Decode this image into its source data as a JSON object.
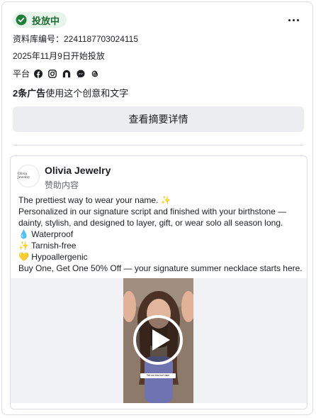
{
  "status": {
    "label": "投放中",
    "color": "#1e6a33",
    "icon": "check-circle-icon"
  },
  "menu": {
    "icon": "more-horizontal-icon"
  },
  "meta": {
    "library_id": "资料库编号：2241187703024115",
    "start_date": "2025年11月9日开始投放",
    "platform_label": "平台",
    "platform_icons": [
      "facebook-icon",
      "instagram-icon",
      "audience-network-icon",
      "messenger-icon",
      "threads-icon"
    ]
  },
  "ads_summary": {
    "count": "2条广告",
    "suffix": "使用这个创意和文字"
  },
  "detail_button": {
    "label": "查看摘要详情"
  },
  "ad": {
    "avatar_text": "Olivia Jewelry",
    "advertiser": "Olivia Jewelry",
    "sponsored": "赞助内容",
    "lines": [
      "The prettiest way to wear your name. ✨",
      "Personalized in our signature script and finished with your birthstone —",
      "dainty, stylish, and designed to layer, gift, or wear solo all season long.",
      "💧 Waterproof",
      "✨ Tarnish-free",
      "💛 Hypoallergenic",
      "Buy One, Get One 50% Off — your signature summer necklace starts here."
    ],
    "video_caption": "Tell me this isn't fake",
    "play_icon": "play-icon"
  }
}
